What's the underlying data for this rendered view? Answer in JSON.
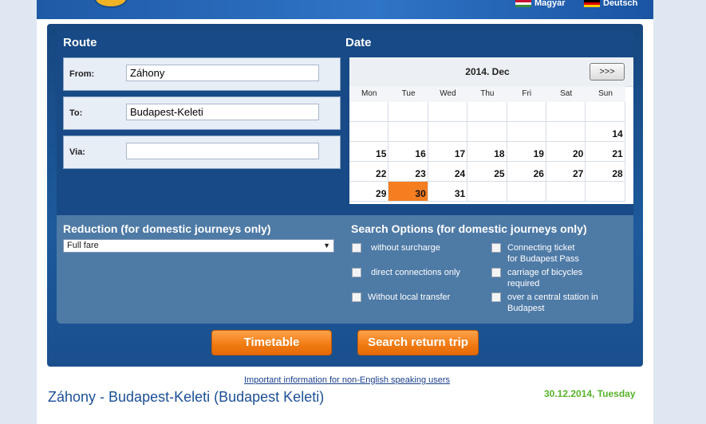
{
  "header": {
    "languages": [
      {
        "label": "Magyar",
        "flag": "hungary-flag-icon"
      },
      {
        "label": "Deutsch",
        "flag": "germany-flag-icon"
      }
    ]
  },
  "route": {
    "heading": "Route",
    "from": {
      "label": "From:",
      "value": "Záhony"
    },
    "to": {
      "label": "To:",
      "value": "Budapest-Keleti"
    },
    "via": {
      "label": "Via:",
      "value": ""
    }
  },
  "date": {
    "heading": "Date",
    "month_title": "2014. Dec",
    "next_label": ">>>",
    "weekdays": [
      "Mon",
      "Tue",
      "Wed",
      "Thu",
      "Fri",
      "Sat",
      "Sun"
    ],
    "weeks": [
      [
        "",
        "",
        "",
        "",
        "",
        "",
        ""
      ],
      [
        "",
        "",
        "",
        "",
        "",
        "",
        "14"
      ],
      [
        "15",
        "16",
        "17",
        "18",
        "19",
        "20",
        "21"
      ],
      [
        "22",
        "23",
        "24",
        "25",
        "26",
        "27",
        "28"
      ],
      [
        "29",
        "30",
        "31",
        "",
        "",
        "",
        ""
      ]
    ],
    "selected_day": "30",
    "selected_color": "#f47e20"
  },
  "reduction": {
    "heading": "Reduction (for domestic journeys only)",
    "selected": "Full fare"
  },
  "search_options": {
    "heading": "Search Options (for domestic journeys only)",
    "left": [
      "without surcharge",
      "direct connections only",
      "Without local transfer"
    ],
    "right": [
      "Connecting ticket\nfor Budapest Pass",
      "carriage of bicycles\nrequired",
      "over a central station in\nBudapest"
    ]
  },
  "buttons": {
    "timetable": "Timetable",
    "return_trip": "Search return trip"
  },
  "footer": {
    "info_link": "Important information for non-English speaking users",
    "route_title": "Záhony - Budapest-Keleti (Budapest Keleti)",
    "route_date": "30.12.2014, Tuesday"
  },
  "colors": {
    "panel_blue": "#174a86",
    "accent_orange": "#f07a12",
    "date_green": "#58b32a"
  }
}
